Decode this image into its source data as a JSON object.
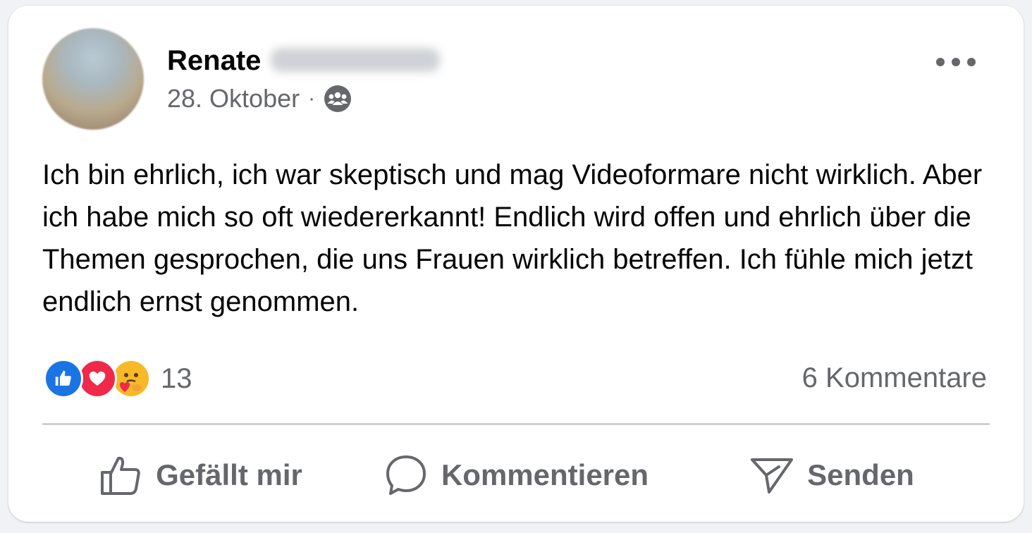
{
  "post": {
    "author_first_name": "Renate",
    "date": "28. Oktober",
    "separator": "·",
    "audience_icon": "group-icon",
    "more_icon": "more-options-icon",
    "text": "Ich bin ehrlich, ich war skeptisch und mag Videoformare nicht wirklich. Aber ich habe mich so oft wiedererkannt! Endlich wird offen und ehrlich über die Themen gesprochen, die uns Frauen wirklich betreffen. Ich fühle mich jetzt endlich ernst genommen."
  },
  "engagement": {
    "reaction_icons": [
      "like-reaction-icon",
      "love-reaction-icon",
      "care-reaction-icon"
    ],
    "reaction_count": "13",
    "comments_label": "6 Kommentare"
  },
  "actions": {
    "like_label": "Gefällt mir",
    "comment_label": "Kommentieren",
    "send_label": "Senden"
  },
  "colors": {
    "text_primary": "#050505",
    "text_secondary": "#65676b",
    "like_blue": "#1b74e4",
    "love_red": "#f0284a",
    "care_yellow": "#f7b928",
    "divider": "#ced0d4"
  }
}
